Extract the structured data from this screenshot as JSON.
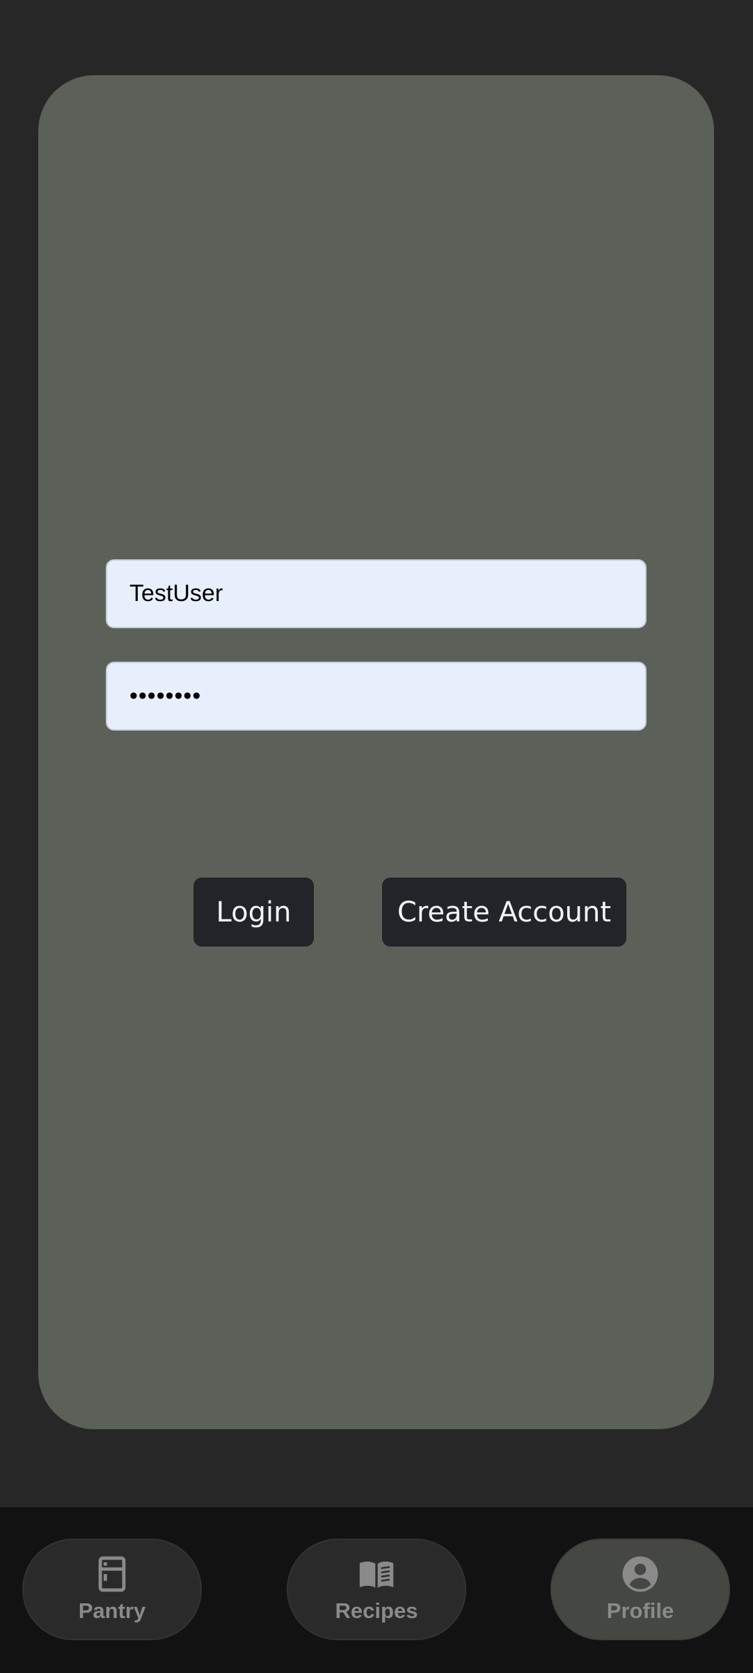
{
  "login_form": {
    "username_value": "TestUser",
    "password_value": "••••••••",
    "login_label": "Login",
    "create_account_label": "Create Account"
  },
  "bottom_nav": {
    "items": [
      {
        "label": "Pantry",
        "icon": "fridge-icon",
        "active": false
      },
      {
        "label": "Recipes",
        "icon": "open-book-icon",
        "active": false
      },
      {
        "label": "Profile",
        "icon": "account-circle-icon",
        "active": true
      }
    ]
  },
  "colors": {
    "background": "#272727",
    "card": "#5b6059",
    "input_background": "#e8effc",
    "button": "#212428",
    "nav_background": "#121212",
    "nav_item": "#2a2a2a",
    "nav_item_active": "#454842",
    "nav_text": "#8a8a8a"
  }
}
